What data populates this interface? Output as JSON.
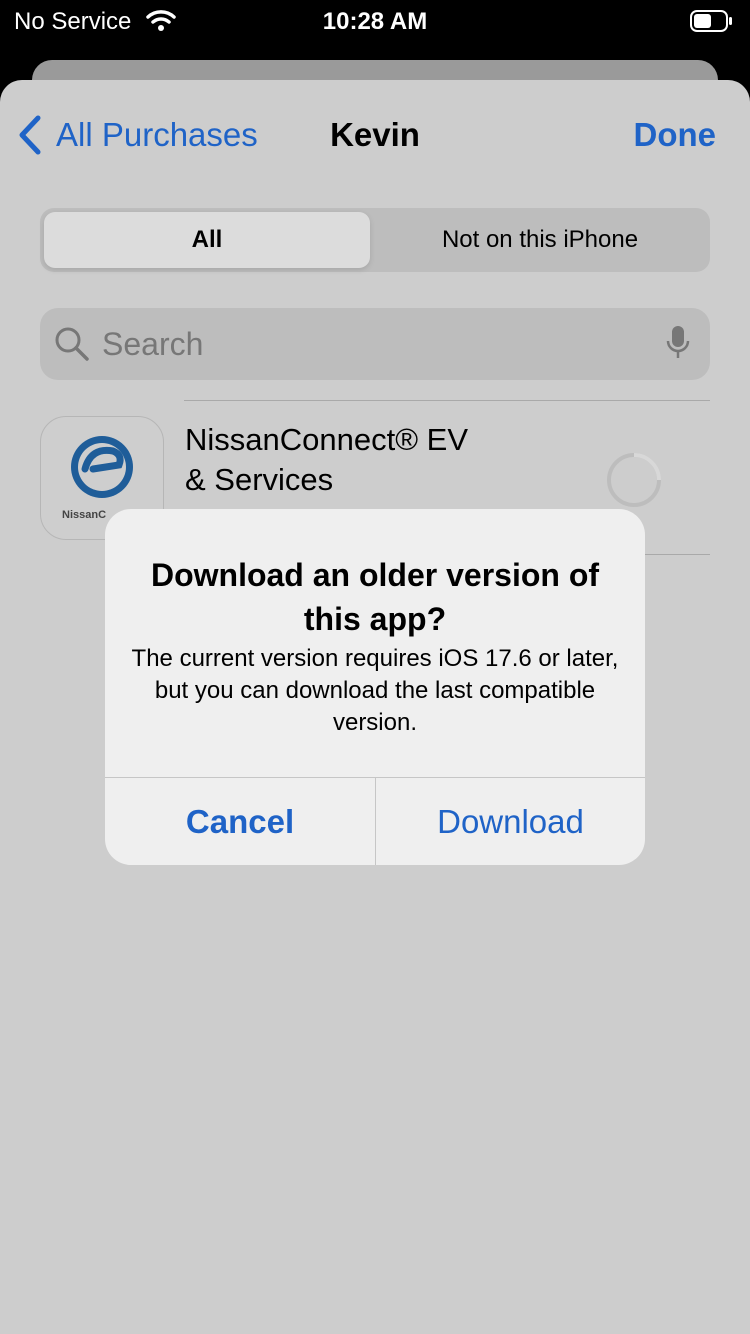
{
  "status_bar": {
    "carrier": "No Service",
    "time": "10:28 AM",
    "icons": [
      "wifi-icon",
      "battery-icon"
    ]
  },
  "nav": {
    "back_label": "All Purchases",
    "title": "Kevin",
    "done_label": "Done"
  },
  "segments": {
    "all_label": "All",
    "not_on_device_label": "Not on this iPhone",
    "selected": "All"
  },
  "search": {
    "placeholder": "Search",
    "icons": [
      "search-icon",
      "microphone-icon"
    ]
  },
  "app_list": [
    {
      "name_line1": "NissanConnect® EV",
      "name_line2": "& Services",
      "icon_text": "NissanC",
      "status_icon": "loading-spinner-icon"
    }
  ],
  "alert": {
    "title": "Download an older version of this app?",
    "message": "The current version requires iOS 17.6 or later, but you can download the last compatible version.",
    "cancel_label": "Cancel",
    "download_label": "Download"
  },
  "colors": {
    "accent": "#1f63c7",
    "sheet_background": "#cdcdcd",
    "alert_background": "#efefef"
  }
}
